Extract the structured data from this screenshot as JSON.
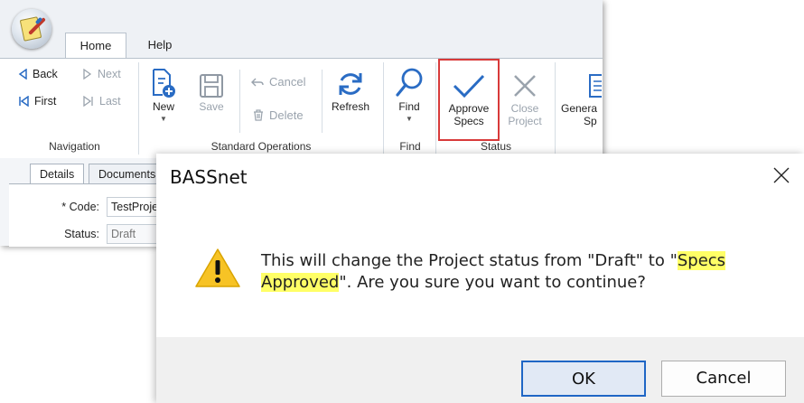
{
  "app": {
    "tabs": {
      "home": "Home",
      "help": "Help"
    },
    "navigation": {
      "back": "Back",
      "next": "Next",
      "first": "First",
      "last": "Last",
      "group_label": "Navigation"
    },
    "standard_operations": {
      "new": "New",
      "save": "Save",
      "cancel": "Cancel",
      "delete": "Delete",
      "refresh": "Refresh",
      "group_label": "Standard Operations"
    },
    "find": {
      "button": "Find",
      "group_label": "Find"
    },
    "status": {
      "approve_line1": "Approve",
      "approve_line2": "Specs",
      "close_line1": "Close",
      "close_line2": "Project",
      "group_label": "Status"
    },
    "generate": {
      "line1": "Genera",
      "line2": "Sp"
    },
    "doc_tabs": {
      "details": "Details",
      "documents": "Documents"
    },
    "form": {
      "code_label": "* Code:",
      "code_value": "TestProje",
      "status_label": "Status:",
      "status_value": "Draft"
    }
  },
  "dialog": {
    "title": "BASSnet",
    "message_part1": "This will change the Project status from \"Draft\" to \"",
    "message_highlight1": "Specs",
    "message_highlight2": "Approved",
    "message_part2": "\". Are you sure you want to continue?",
    "ok_label": "OK",
    "cancel_label": "Cancel"
  },
  "colors": {
    "accent_blue": "#1f66c5",
    "highlight_box": "#d83a3a",
    "text_highlight": "#ffff66",
    "warning_yellow": "#f7c325"
  }
}
